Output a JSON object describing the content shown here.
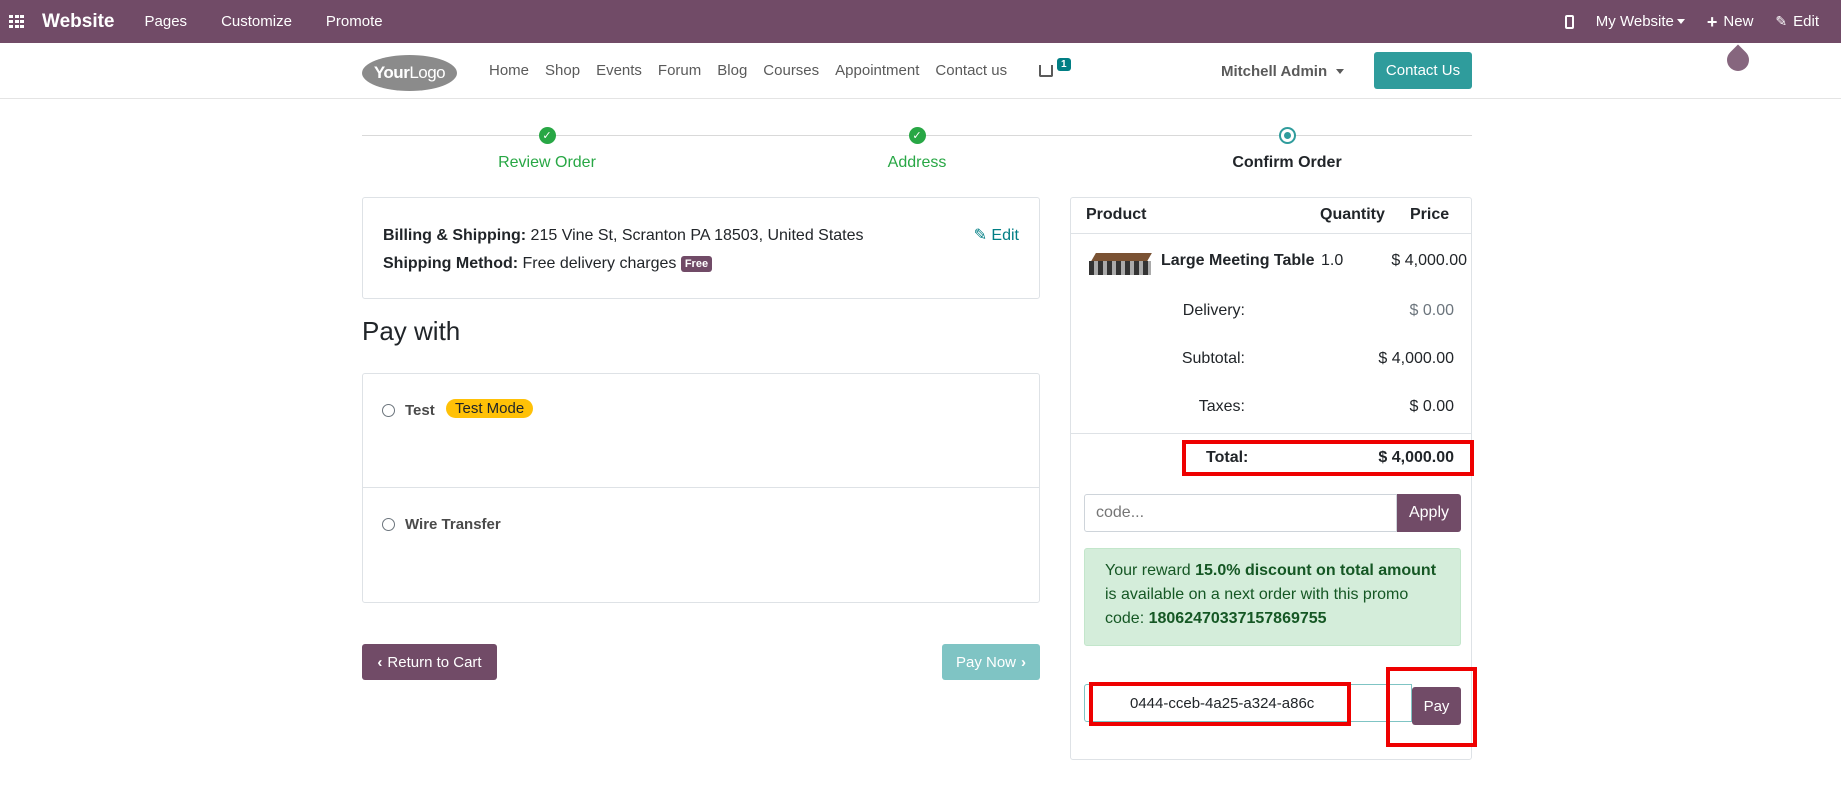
{
  "topbar": {
    "brand": "Website",
    "menus": [
      "Pages",
      "Customize",
      "Promote"
    ],
    "site_selector": "My Website",
    "new_label": "New",
    "edit_label": "Edit"
  },
  "nav": {
    "logo_your": "Your",
    "logo_logo": "Logo",
    "links": [
      "Home",
      "Shop",
      "Events",
      "Forum",
      "Blog",
      "Courses",
      "Appointment",
      "Contact us"
    ],
    "cart_count": "1",
    "user": "Mitchell Admin",
    "contact_button": "Contact Us"
  },
  "steps": [
    {
      "label": "Review Order",
      "state": "done"
    },
    {
      "label": "Address",
      "state": "done"
    },
    {
      "label": "Confirm Order",
      "state": "current"
    }
  ],
  "billing": {
    "billing_label": "Billing & Shipping:",
    "billing_value": "215 Vine St, Scranton PA 18503, United States",
    "shipping_label": "Shipping Method:",
    "shipping_value": "Free delivery charges",
    "free_badge": "Free",
    "edit_label": "Edit"
  },
  "pay_with": {
    "title": "Pay with",
    "options": [
      {
        "name": "Test",
        "badge": "Test Mode"
      },
      {
        "name": "Wire Transfer"
      }
    ]
  },
  "buttons": {
    "return_to_cart": "Return to Cart",
    "pay_now": "Pay Now"
  },
  "summary": {
    "headers": {
      "product": "Product",
      "quantity": "Quantity",
      "price": "Price"
    },
    "item": {
      "name": "Large Meeting Table",
      "qty": "1.0",
      "price": "$ 4,000.00"
    },
    "delivery_label": "Delivery:",
    "delivery_value": "$ 0.00",
    "subtotal_label": "Subtotal:",
    "subtotal_value": "$ 4,000.00",
    "taxes_label": "Taxes:",
    "taxes_value": "$ 0.00",
    "total_label": "Total:",
    "total_value": "$ 4,000.00",
    "promo_placeholder": "code...",
    "apply_label": "Apply",
    "reward_pre": "Your reward ",
    "reward_bold": "15.0% discount on total amount",
    "reward_post": " is available on a next order with this promo code: ",
    "reward_code": "18062470337157869755",
    "token_value": "0444-cceb-4a25-a324-a86c",
    "pay_label": "Pay"
  },
  "colors": {
    "brand": "#714b67",
    "accent": "#2f9c9c",
    "success": "#28a745",
    "highlight": "#ee0000"
  }
}
